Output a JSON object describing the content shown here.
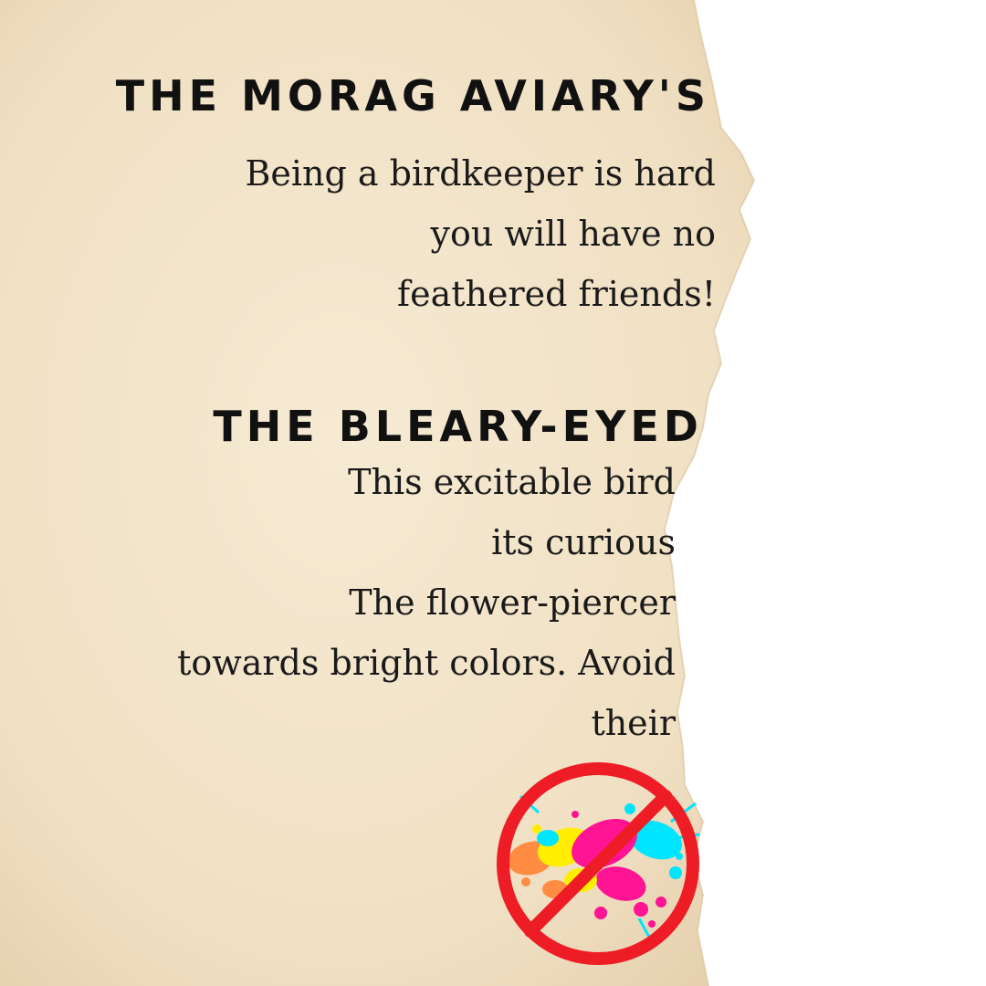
{
  "section1": {
    "title": "THE MORAG AVIARY'S",
    "lines": [
      "Being a birdkeeper is hard",
      "you will have no",
      "feathered friends!"
    ]
  },
  "section2": {
    "title": "THE BLEARY-EYED",
    "lines": [
      "This excitable bird",
      "its curious",
      "The flower-piercer",
      "towards bright colors. Avoid",
      "their"
    ]
  },
  "sign": {
    "icon": "no-paint-splatter-icon"
  },
  "colors": {
    "paper": "#f4e6cd",
    "text": "#111111",
    "prohibition": "#ee1c25",
    "splatter": [
      "#ff1493",
      "#00e5ff",
      "#ffee00",
      "#ff8c42"
    ]
  }
}
